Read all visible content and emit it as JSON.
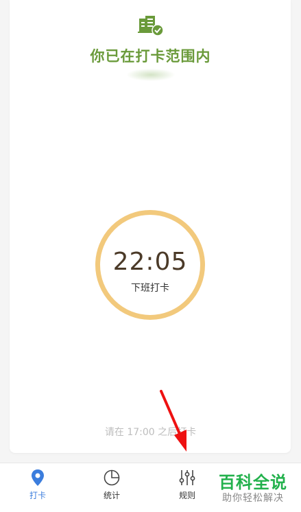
{
  "status": {
    "range_text": "你已在打卡范围内",
    "icon": "building-check-icon",
    "color": "#6a9a3a"
  },
  "clock": {
    "time": "22:05",
    "label": "下班打卡",
    "ring_color": "#f2c97c"
  },
  "hint": {
    "text": "请在 17:00 之后打卡"
  },
  "tabbar": {
    "tabs": [
      {
        "label": "打卡",
        "icon": "location-pin-icon",
        "active": true
      },
      {
        "label": "统计",
        "icon": "pie-chart-icon",
        "active": false
      },
      {
        "label": "规则",
        "icon": "sliders-icon",
        "active": false
      }
    ],
    "active_color": "#3b7ddd"
  },
  "watermark": {
    "title": "百科全说",
    "subtitle": "助你轻松解决"
  },
  "annotation": {
    "arrow_color": "#ee1111"
  }
}
